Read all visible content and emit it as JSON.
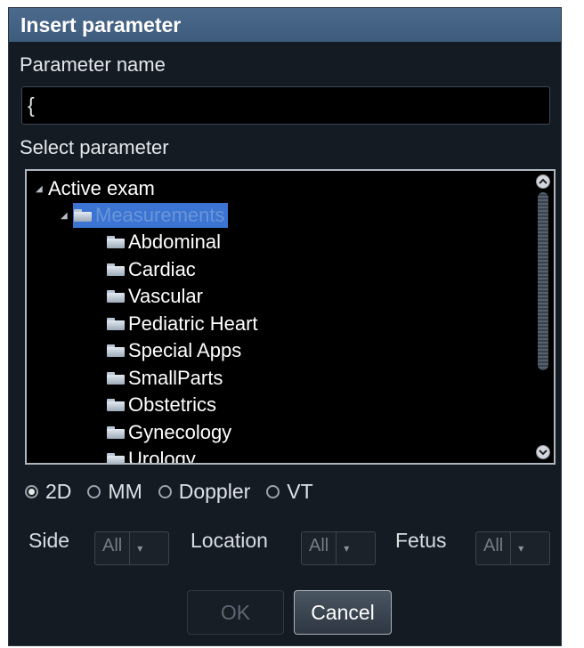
{
  "dialog": {
    "title": "Insert parameter",
    "parameter_name_label": "Parameter name",
    "parameter_name_value": "{",
    "select_parameter_label": "Select parameter"
  },
  "tree": {
    "root": "Active exam",
    "selected": "Measurements",
    "children": [
      "Abdominal",
      "Cardiac",
      "Vascular",
      "Pediatric Heart",
      "Special Apps",
      "SmallParts",
      "Obstetrics",
      "Gynecology",
      "Urology"
    ]
  },
  "modes": {
    "selected": "2D",
    "options": [
      "2D",
      "MM",
      "Doppler",
      "VT"
    ]
  },
  "filters": {
    "side_label": "Side",
    "side_value": "All",
    "location_label": "Location",
    "location_value": "All",
    "fetus_label": "Fetus",
    "fetus_value": "All"
  },
  "buttons": {
    "ok": "OK",
    "cancel": "Cancel"
  },
  "icons": [
    "triangle-collapse-icon",
    "folder-icon",
    "scroll-up-icon",
    "scroll-down-icon",
    "chevron-down-icon"
  ]
}
